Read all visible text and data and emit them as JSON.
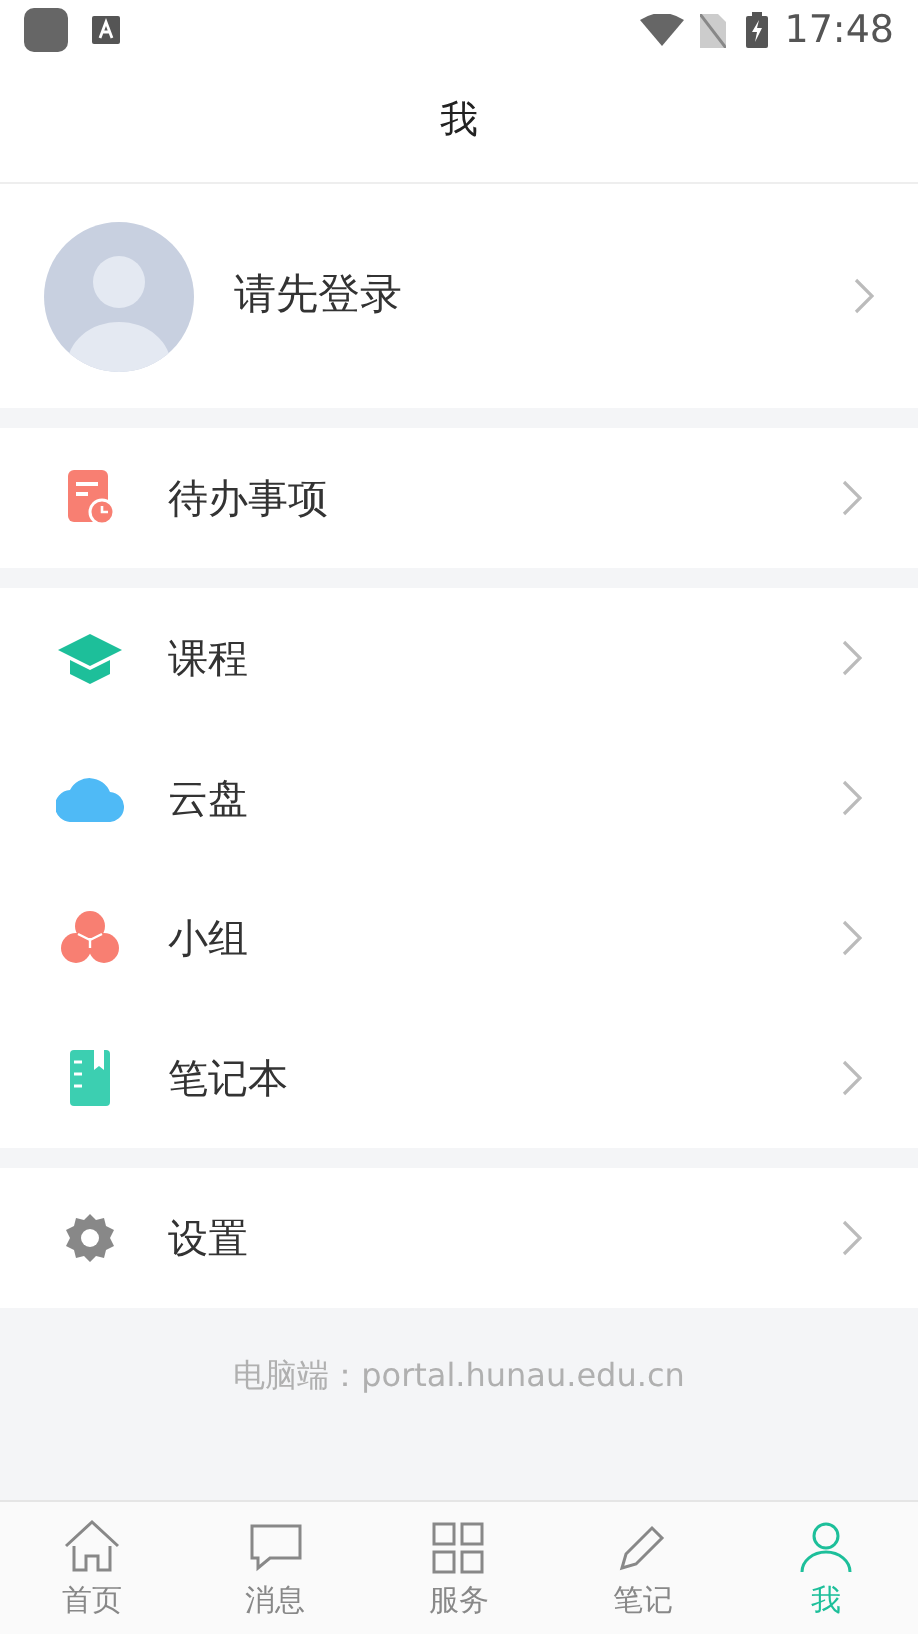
{
  "status_bar": {
    "time": "17:48"
  },
  "header": {
    "title": "我"
  },
  "profile": {
    "name": "请先登录"
  },
  "sections": [
    [
      {
        "kind": "todo",
        "label": "待办事项"
      }
    ],
    [
      {
        "kind": "course",
        "label": "课程"
      },
      {
        "kind": "cloud",
        "label": "云盘"
      },
      {
        "kind": "group",
        "label": "小组"
      },
      {
        "kind": "notebook",
        "label": "笔记本"
      }
    ],
    [
      {
        "kind": "settings",
        "label": "设置"
      }
    ]
  ],
  "footer": {
    "text": "电脑端：portal.hunau.edu.cn"
  },
  "tabs": [
    {
      "kind": "home",
      "label": "首页",
      "selected": false
    },
    {
      "kind": "message",
      "label": "消息",
      "selected": false
    },
    {
      "kind": "service",
      "label": "服务",
      "selected": false
    },
    {
      "kind": "note",
      "label": "笔记",
      "selected": false
    },
    {
      "kind": "me",
      "label": "我",
      "selected": true
    }
  ]
}
